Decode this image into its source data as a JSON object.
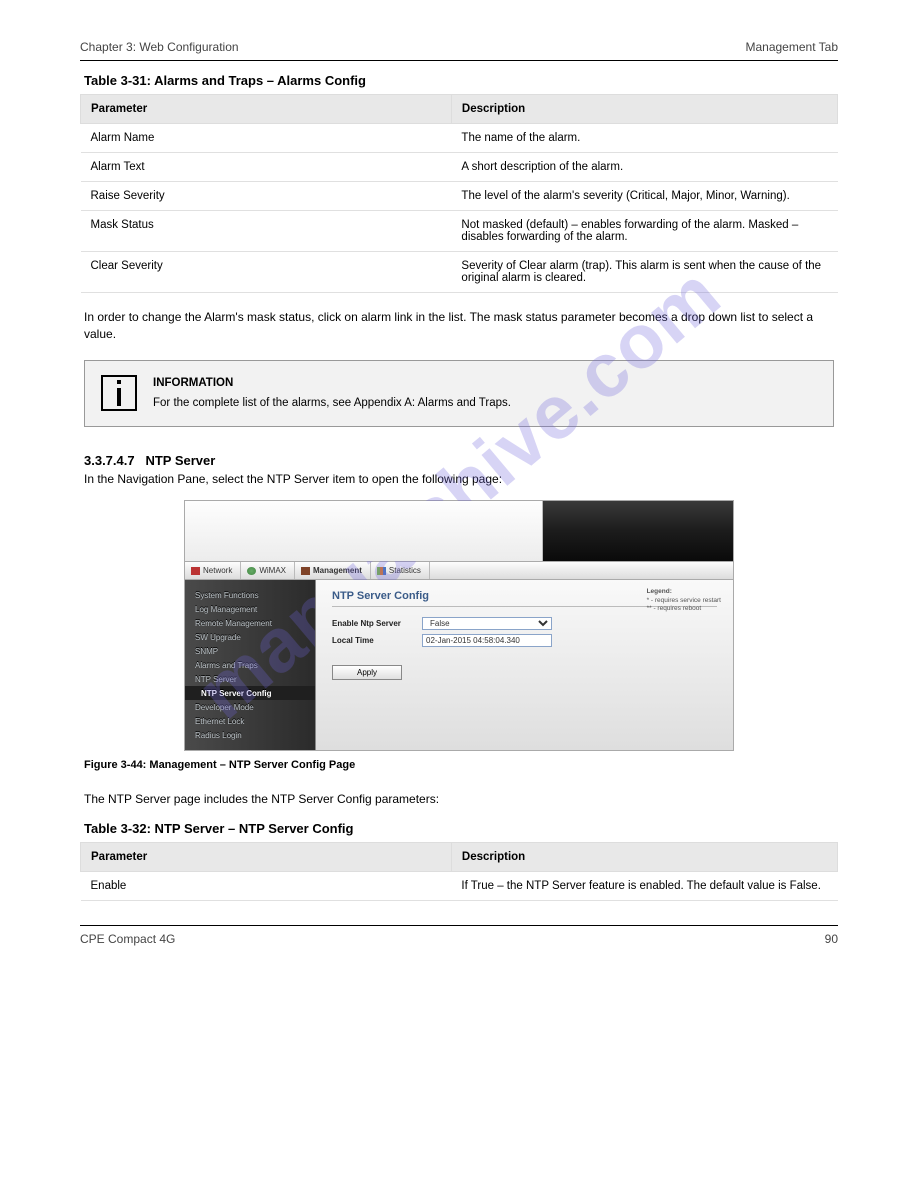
{
  "header": {
    "chapter": "Chapter 3: Web Configuration",
    "section": "Management Tab"
  },
  "watermark": "manualshive.com",
  "table1": {
    "caption": "Table 3-31: Alarms and Traps – Alarms Config",
    "cols": [
      "Parameter",
      "Description"
    ],
    "rows": [
      [
        "Alarm Name",
        "The name of the alarm."
      ],
      [
        "Alarm Text",
        "A short description of the alarm."
      ],
      [
        "Raise Severity",
        "The level of the alarm's severity (Critical, Major, Minor, Warning)."
      ],
      [
        "Mask Status",
        "Not masked (default) – enables forwarding of the alarm. Masked – disables forwarding of the alarm."
      ],
      [
        "Clear Severity",
        "Severity of Clear alarm (trap). This alarm is sent when the cause of the original alarm is cleared."
      ]
    ]
  },
  "body1": "In order to change the Alarm's mask status, click on alarm link in the list. The mask status parameter becomes a drop down list to select a value.",
  "note": {
    "label": "INFORMATION",
    "text": "For the complete list of the alarms, see Appendix A: Alarms and Traps."
  },
  "section2": {
    "num": "3.3.7.4.7",
    "title": "NTP Server",
    "desc": "In the Navigation Pane, select the NTP Server item to open the following page:"
  },
  "scr": {
    "tabs": [
      "Network",
      "WiMAX",
      "Management",
      "Statistics"
    ],
    "sidebar": [
      "System Functions",
      "Log Management",
      "Remote Management",
      "SW Upgrade",
      "SNMP",
      "Alarms and Traps",
      "NTP Server",
      "NTP Server Config",
      "Developer Mode",
      "Ethernet Lock",
      "Radius Login"
    ],
    "title": "NTP Server Config",
    "legend": {
      "title": "Legend:",
      "l1": "* - requires service restart",
      "l2": "** - requires reboot"
    },
    "rows": {
      "enable_label": "Enable Ntp Server",
      "enable_value": "False",
      "localtime_label": "Local Time",
      "localtime_value": "02-Jan-2015 04:58:04.340"
    },
    "apply": "Apply"
  },
  "figure": "Figure 3-44: Management – NTP Server Config Page",
  "body2": "The NTP Server page includes the NTP Server Config parameters:",
  "table2": {
    "caption": "Table 3-32: NTP Server – NTP Server Config",
    "cols": [
      "Parameter",
      "Description"
    ],
    "rows": [
      [
        "Enable",
        "If True – the NTP Server feature is enabled. The default value is False."
      ]
    ]
  },
  "footer": {
    "left": "CPE Compact 4G",
    "right": "90"
  }
}
